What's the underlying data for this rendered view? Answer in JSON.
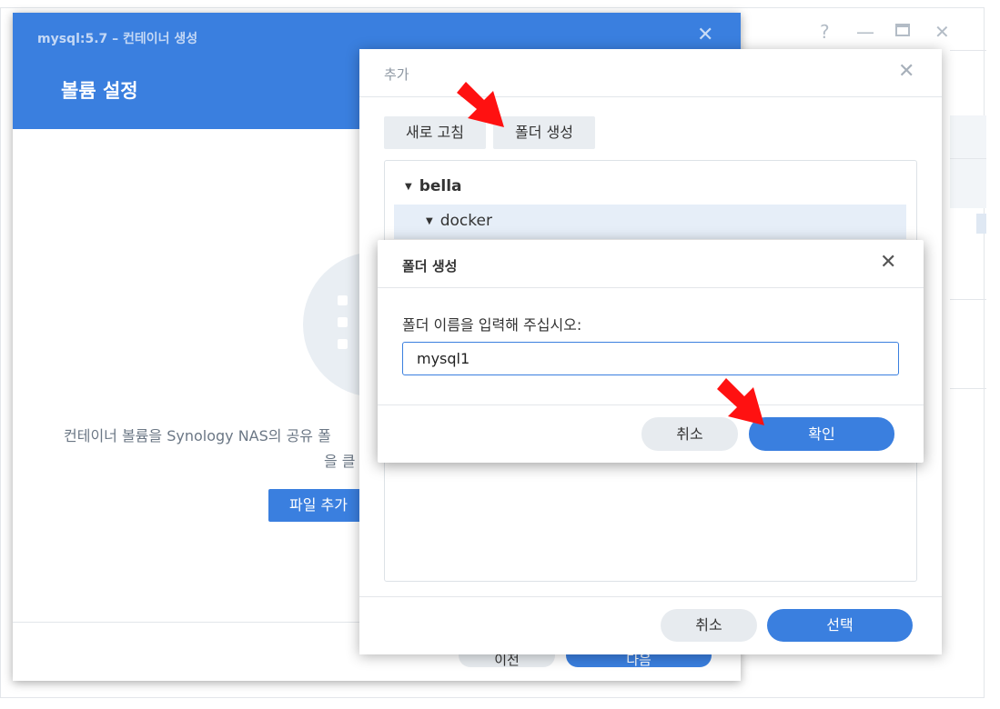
{
  "background_window": {
    "controls": {
      "help": "?",
      "minimize": "—",
      "maximize": "🗖",
      "close": "✕"
    }
  },
  "wizard": {
    "title": "mysql:5.7 – 컨테이너 생성",
    "close": "✕",
    "subtitle": "볼륨 설정",
    "description_line1": "컨테이너 볼륨을 Synology NAS의 공유 폴",
    "description_line2": "을 클",
    "add_file_button": "파일 추가",
    "footer_left": "이전",
    "footer_right": "다음"
  },
  "add_dialog": {
    "title": "추가",
    "close": "✕",
    "refresh_button": "새로 고침",
    "create_folder_button": "폴더 생성",
    "tree": [
      {
        "label": "bella",
        "expanded": true
      },
      {
        "label": "docker",
        "expanded": true,
        "selected": true
      }
    ],
    "cancel_button": "취소",
    "select_button": "선택"
  },
  "folder_dialog": {
    "title": "폴더 생성",
    "close": "✕",
    "prompt": "폴더 이름을 입력해 주십시오:",
    "input_value": "mysql1",
    "cancel_button": "취소",
    "ok_button": "확인"
  },
  "colors": {
    "accent": "#3a7fdf",
    "arrow": "#ff1111"
  }
}
